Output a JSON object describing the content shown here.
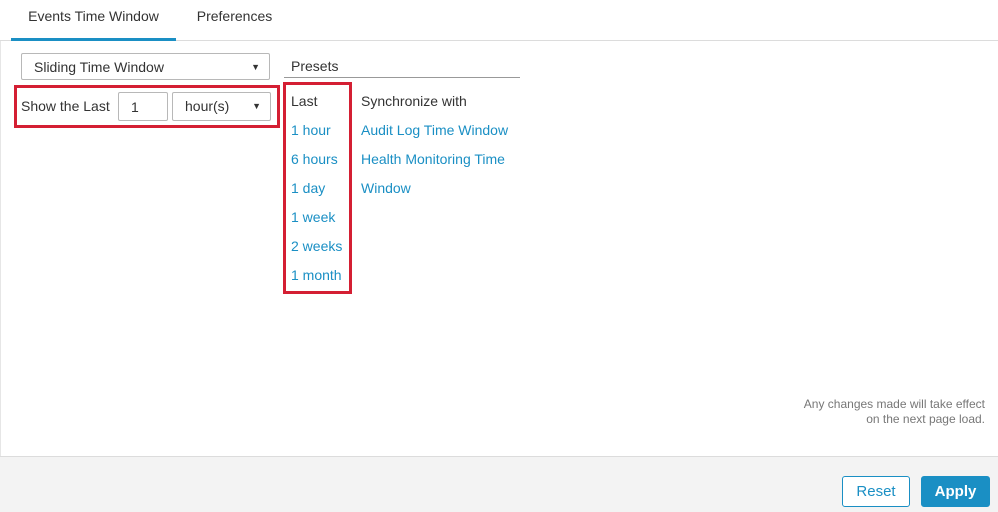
{
  "tabs": [
    {
      "label": "Events Time Window",
      "active": true
    },
    {
      "label": "Preferences",
      "active": false
    }
  ],
  "window_mode": {
    "value": "Sliding Time Window",
    "caret": "▼"
  },
  "show_last": {
    "label": "Show the Last",
    "count": "1",
    "unit": "hour(s)",
    "caret": "▼"
  },
  "presets": {
    "title": "Presets",
    "last_header": "Last",
    "last_items": [
      "1 hour",
      "6 hours",
      "1 day",
      "1 week",
      "2 weeks",
      "1 month"
    ],
    "sync_header": "Synchronize with",
    "sync_items": [
      "Audit Log Time Window",
      "Health Monitoring Time",
      "Window"
    ]
  },
  "note": {
    "line1": "Any changes made will take effect",
    "line2": "on the next page load."
  },
  "footer": {
    "reset_label": "Reset",
    "apply_label": "Apply"
  },
  "colors": {
    "accent": "#1a8fc4",
    "highlight": "#d41f33"
  }
}
